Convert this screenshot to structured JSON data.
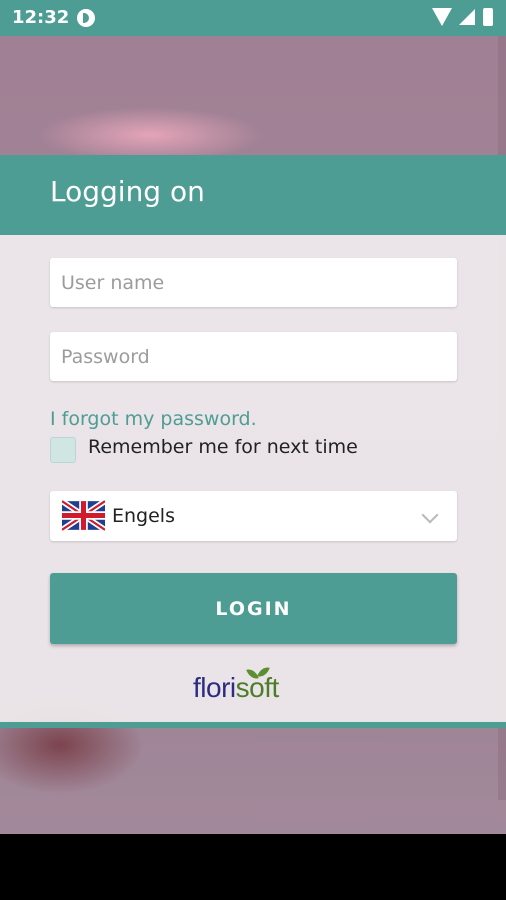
{
  "status_bar": {
    "time": "12:32"
  },
  "header": {
    "title": "Logging on"
  },
  "form": {
    "username_placeholder": "User name",
    "password_placeholder": "Password",
    "forgot_link": "I forgot my password.",
    "remember_label": "Remember me for next time",
    "remember_checked": false,
    "language_value": "Engels",
    "language_flag": "uk-flag-icon",
    "login_label": "LOGIN"
  },
  "logo": {
    "part1": "flori",
    "part2": "soft"
  },
  "colors": {
    "accent": "#4e9d94",
    "logo_blue": "#2b2c82",
    "logo_green": "#4d7d2a"
  }
}
